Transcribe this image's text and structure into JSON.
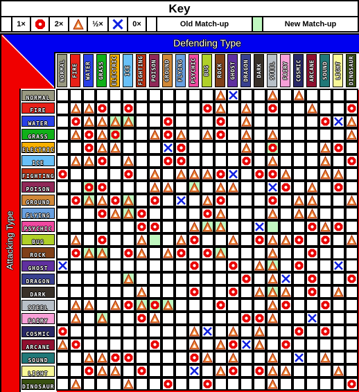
{
  "key": {
    "title": "Key",
    "items": [
      {
        "icon": "none",
        "label": "1×"
      },
      {
        "icon": "red-circle",
        "label": "2×"
      },
      {
        "icon": "orange-triangle",
        "label": "½×"
      },
      {
        "icon": "blue-x",
        "label": "0×"
      }
    ],
    "old_label": "Old Match-up",
    "new_label": "New Match-up",
    "new_color": "#c0f8c0"
  },
  "defending_title": "Defending Type",
  "attacking_title": "Attacking Type",
  "types": [
    {
      "name": "NORMAL",
      "color": "#989880"
    },
    {
      "name": "FIRE",
      "color": "#e82018"
    },
    {
      "name": "WATER",
      "color": "#2840e8"
    },
    {
      "name": "GRASS",
      "color": "#10b018"
    },
    {
      "name": "ELECTRIC",
      "color": "#f8b000"
    },
    {
      "name": "ICE",
      "color": "#68c0f8"
    },
    {
      "name": "FIGHTING",
      "color": "#c03010"
    },
    {
      "name": "POISON",
      "color": "#902858"
    },
    {
      "name": "GROUND",
      "color": "#d08838"
    },
    {
      "name": "FLYING",
      "color": "#68a0e0"
    },
    {
      "name": "PSYCHIC",
      "color": "#f048a0"
    },
    {
      "name": "BUG",
      "color": "#b0d028"
    },
    {
      "name": "ROCK",
      "color": "#804018"
    },
    {
      "name": "GHOST",
      "color": "#6030a0"
    },
    {
      "name": "DRAGON",
      "color": "#384090"
    },
    {
      "name": "DARK",
      "color": "#383028"
    },
    {
      "name": "STEEL",
      "color": "#b8c0c8"
    },
    {
      "name": "FAIRY",
      "color": "#f8a0d8"
    },
    {
      "name": "COSMIC",
      "color": "#282868"
    },
    {
      "name": "ARCANE",
      "color": "#901030"
    },
    {
      "name": "SOUND",
      "color": "#207878"
    },
    {
      "name": "LIGHT",
      "color": "#f8f898"
    },
    {
      "name": "DINOSAUR",
      "color": "#385010"
    }
  ],
  "matrix_legend": {
    "": "1x",
    "2": "2x",
    "h": "1/2x",
    "0": "0x",
    "g_suffix": "new match-up"
  },
  "matrix": [
    [
      "",
      "",
      "",
      "",
      "",
      "",
      "",
      "",
      "",
      "",
      "",
      "",
      "h",
      "0",
      "",
      "",
      "h",
      "",
      "h",
      "",
      "",
      "",
      ""
    ],
    [
      "",
      "h",
      "h",
      "2",
      "",
      "2",
      "",
      "",
      "",
      "",
      "",
      "2",
      "h",
      "",
      "h",
      "",
      "2",
      "",
      "",
      "h",
      "",
      "",
      "2"
    ],
    [
      "",
      "2",
      "h",
      "h",
      "hg",
      "hg",
      "",
      "",
      "2",
      "",
      "",
      "",
      "2",
      "",
      "h",
      "",
      "",
      "",
      "",
      "",
      "2",
      "0",
      "h"
    ],
    [
      "",
      "h",
      "2",
      "h",
      "2g",
      "",
      "",
      "h",
      "2",
      "h",
      "",
      "h",
      "2",
      "",
      "h",
      "",
      "h",
      "",
      "",
      "",
      "",
      "",
      "h"
    ],
    [
      "",
      "",
      "2",
      "h",
      "h",
      "",
      "",
      "",
      "0",
      "2",
      "",
      "",
      "",
      "",
      "h",
      "",
      "2g",
      "",
      "",
      "",
      "h",
      "2",
      ""
    ],
    [
      "",
      "h",
      "h",
      "2",
      "",
      "h",
      "",
      "",
      "2",
      "2",
      "",
      "",
      "",
      "",
      "2",
      "",
      "h",
      "",
      "",
      "",
      "h",
      "",
      "2"
    ],
    [
      "2",
      "",
      "",
      "",
      "",
      "2",
      "",
      "h",
      "",
      "h",
      "h",
      "h",
      "2",
      "0",
      "",
      "2",
      "2",
      "h",
      "",
      "",
      "h",
      "h",
      ""
    ],
    [
      "",
      "",
      "2g",
      "2",
      "",
      "",
      "",
      "h",
      "h",
      "",
      "hg",
      "",
      "h",
      "h",
      "",
      "",
      "0",
      "2",
      "",
      "h",
      "",
      "2",
      ""
    ],
    [
      "",
      "2",
      "hg",
      "h",
      "2",
      "hg",
      "",
      "2",
      "",
      "0",
      "",
      "h",
      "2",
      "",
      "",
      "",
      "2",
      "",
      "h",
      "h",
      "",
      "",
      "h"
    ],
    [
      "",
      "",
      "",
      "2",
      "h",
      "hg",
      "2",
      "",
      "",
      "",
      "",
      "2",
      "h",
      "",
      "",
      "",
      "h",
      "",
      "h",
      "h",
      "",
      "",
      ""
    ],
    [
      "",
      "",
      "",
      "",
      "",
      "",
      "2",
      "2",
      "",
      "",
      "h",
      "hg",
      "hg",
      "",
      "",
      "0",
      "g",
      "",
      "",
      "2",
      "h",
      "2",
      ""
    ],
    [
      "",
      "h",
      "",
      "2",
      "",
      "",
      "h",
      "g",
      "",
      "h",
      "2",
      "",
      "",
      "h",
      "",
      "2",
      "h",
      "h",
      "2",
      "",
      "2",
      "",
      "h"
    ],
    [
      "",
      "2",
      "hg",
      "hg",
      "",
      "2",
      "h",
      "",
      "h",
      "2",
      "",
      "2",
      "hg",
      "",
      "",
      "",
      "h",
      "",
      "",
      "2",
      "",
      "",
      ""
    ],
    [
      "0",
      "",
      "",
      "",
      "",
      "",
      "",
      "",
      "",
      "",
      "2",
      "",
      "",
      "2",
      "",
      "h",
      "hg",
      "",
      "2",
      "",
      "",
      "0",
      ""
    ],
    [
      "",
      "",
      "",
      "",
      "",
      "hg",
      "",
      "",
      "",
      "",
      "",
      "",
      "",
      "",
      "2",
      "",
      "h",
      "0",
      "",
      "2",
      "",
      "",
      "2"
    ],
    [
      "",
      "",
      "",
      "",
      "",
      "",
      "h",
      "",
      "",
      "",
      "2",
      "",
      "",
      "2",
      "",
      "h",
      "hg",
      "h",
      "",
      "2",
      "",
      "h",
      ""
    ],
    [
      "",
      "h",
      "h",
      "",
      "h",
      "2",
      "hg",
      "2g",
      "hg",
      "",
      "",
      "",
      "2",
      "",
      "",
      "",
      "h",
      "2",
      "",
      "",
      "2",
      "",
      ""
    ],
    [
      "",
      "h",
      "",
      "hg",
      "",
      "",
      "2",
      "h",
      "",
      "",
      "",
      "",
      "",
      "",
      "2",
      "2",
      "h",
      "",
      "",
      "0",
      "",
      "",
      ""
    ],
    [
      "2",
      "",
      "",
      "",
      "",
      "",
      "",
      "",
      "",
      "",
      "h",
      "0",
      "",
      "h",
      "",
      "h",
      "",
      "",
      "2",
      "",
      "2",
      "",
      ""
    ],
    [
      "h",
      "2",
      "",
      "",
      "",
      "",
      "",
      "2",
      "",
      "",
      "h",
      "",
      "h",
      "2",
      "0",
      "h",
      "",
      "2",
      "",
      "",
      "",
      "",
      ""
    ],
    [
      "",
      "",
      "h",
      "h",
      "2",
      "2",
      "",
      "",
      "",
      "",
      "2",
      "h",
      "",
      "h",
      "",
      "",
      "h",
      "",
      "0",
      "",
      "h",
      "",
      ""
    ],
    [
      "",
      "",
      "2",
      "h",
      "h",
      "",
      "2",
      "",
      "",
      "",
      "0",
      "",
      "h",
      "2",
      "",
      "2",
      "h",
      "h",
      "",
      "",
      "",
      "h",
      ""
    ],
    [
      "",
      "h",
      "",
      "",
      "",
      "h",
      "",
      "",
      "2",
      "",
      "",
      "2",
      "",
      "",
      "",
      "",
      "h",
      "",
      "",
      "",
      "",
      "",
      "2"
    ]
  ]
}
